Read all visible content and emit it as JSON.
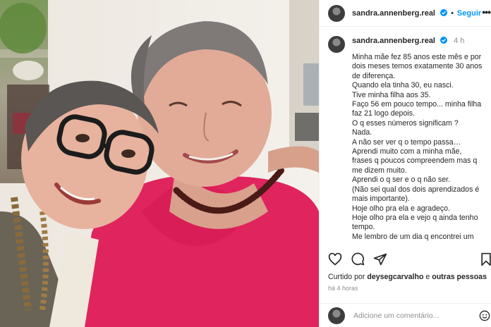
{
  "header": {
    "username": "sandra.annenberg.real",
    "follow_label": "Seguir",
    "separator": "•",
    "more_label": "•••"
  },
  "caption": {
    "username": "sandra.annenberg.real",
    "time": "4 h",
    "lines": [
      "Minha mãe fez 85 anos este mês e por dois meses temos exatamente 30 anos de diferença.",
      "Quando ela tinha 30, eu nasci.",
      "Tive minha filha aos 35.",
      "Faço 56 em pouco tempo... minha filha faz 21 logo depois.",
      "O q esses números significam ?",
      "Nada.",
      "A não ser ver q o tempo passa…",
      "Aprendi muito com a minha mãe, frases q poucos compreendem mas q me dizem muito.",
      "Aprendi o q ser e o q não ser.",
      "(Não sei qual dos dois aprendizados é mais importante).",
      "Hoje olho pra ela e agradeço.",
      "Hoje olho pra ela e vejo q ainda tenho tempo.",
      "Me lembro de um dia q encontrei um"
    ]
  },
  "actions": {
    "like": "heart-icon",
    "comment": "comment-icon",
    "share": "share-icon",
    "save": "bookmark-icon"
  },
  "likes": {
    "prefix": "Curtido por ",
    "user": "deysegcarvalho",
    "middle": " e ",
    "others": "outras pessoas"
  },
  "timestamp": "há 4 horas",
  "comment": {
    "placeholder": "Adicione um comentário..."
  },
  "colors": {
    "accent": "#0095f6",
    "verified": "#0095f6",
    "muted": "#8e8e8e",
    "shirt": "#e0245e"
  }
}
